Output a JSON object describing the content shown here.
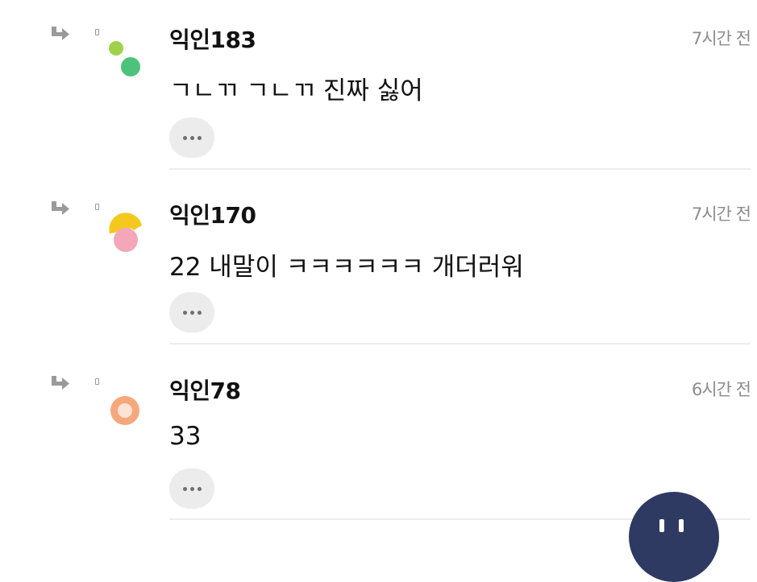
{
  "comments": [
    {
      "username": "익인183",
      "time": "7시간 전",
      "text": "ㄱㄴㄲ ㄱㄴㄲ 진짜 싫어",
      "avatar_colors": [
        "#9fd24a",
        "#4cc27a"
      ]
    },
    {
      "username": "익인170",
      "time": "7시간 전",
      "text": "22 내말이 ㅋㅋㅋㅋㅋㅋ 개더러워",
      "avatar_colors": [
        "#f4c81f",
        "#f3a7b9"
      ]
    },
    {
      "username": "익인78",
      "time": "6시간 전",
      "text": "33",
      "avatar_colors": [
        "#f6a77c",
        "#fde3d6"
      ]
    }
  ],
  "icons": {
    "reply": "reply-arrow-icon",
    "more": "more-options-icon",
    "fab": "write-icon"
  },
  "colors": {
    "fab_background": "#2f3a63",
    "time_text": "#8c8c8c",
    "more_button_background": "#ececec"
  }
}
